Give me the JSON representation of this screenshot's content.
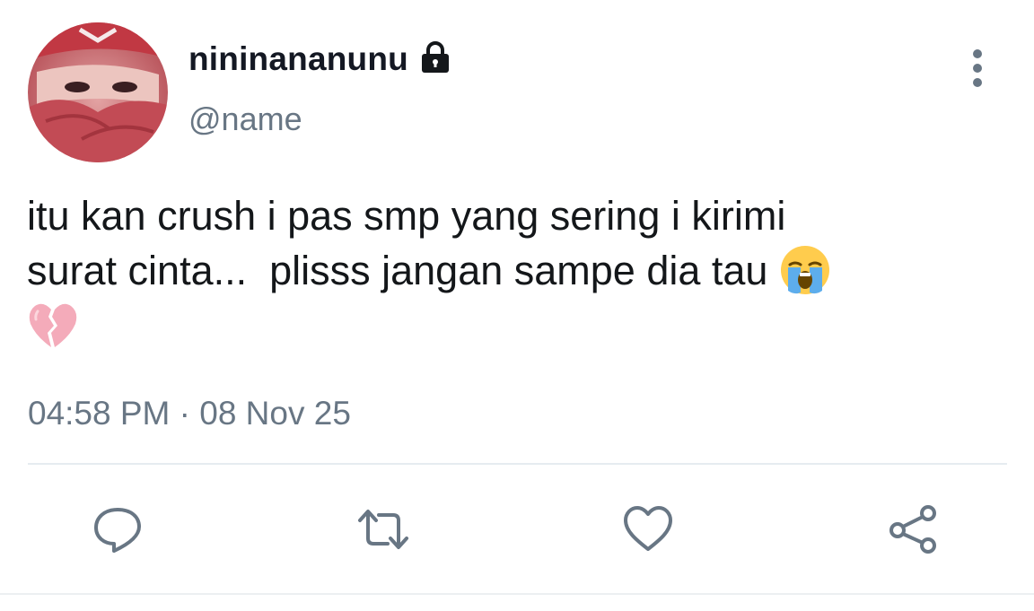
{
  "user": {
    "display_name": "nininananunu",
    "handle": "@name",
    "avatar_icon": "avatar-photo",
    "protected_icon": "lock-icon"
  },
  "tweet": {
    "text_line1": "itu kan crush i pas smp yang sering i kirimi",
    "text_line2": "surat cinta...  plisss jangan sampe dia tau ",
    "emojis": [
      "loudly-crying-face-emoji",
      "broken-heart-emoji"
    ],
    "timestamp": "04:58 PM · 08 Nov 25"
  },
  "actions": {
    "items": [
      "reply-icon",
      "retweet-icon",
      "like-icon",
      "share-icon"
    ]
  },
  "menu": {
    "icon": "more-vertical-icon"
  },
  "colors": {
    "text_primary": "#14171a",
    "text_secondary": "#687684",
    "icon_color": "#687684",
    "divider": "#e6ecf0"
  }
}
